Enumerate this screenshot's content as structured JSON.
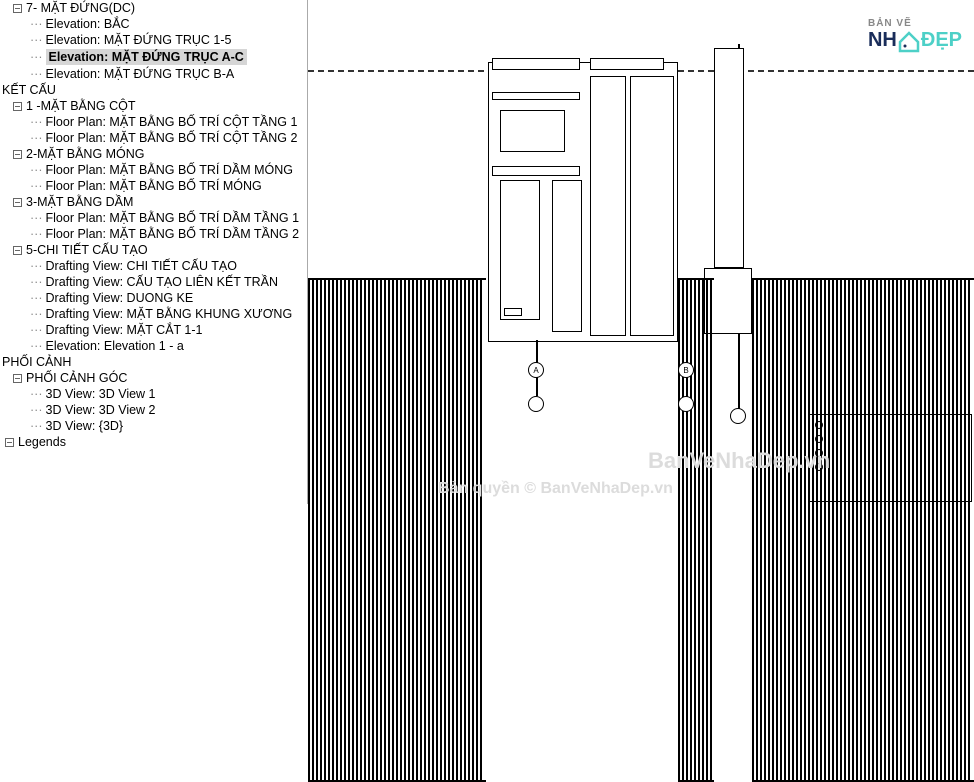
{
  "tree": {
    "group0": "7- MẶT ĐỨNG(DC)",
    "group0_items": [
      "Elevation: BẮC",
      "Elevation: MẶT ĐỨNG TRỤC 1-5",
      "Elevation: MẶT ĐỨNG TRỤC A-C",
      "Elevation: MẶT ĐỨNG TRỤC B-A"
    ],
    "group0_selected": 2,
    "section1": "KẾT CẤU",
    "group1": "1 -MẶT BẰNG CỘT",
    "group1_items": [
      "Floor Plan: MẶT BẰNG BỐ TRÍ CỘT TẦNG 1",
      "Floor Plan: MẶT BẰNG BỐ TRÍ CỘT TẦNG 2"
    ],
    "group2": "2-MẶT BẰNG MÓNG",
    "group2_items": [
      "Floor Plan: MẶT BẰNG BỐ TRÍ DẦM MÓNG",
      "Floor Plan: MẶT BẰNG BỐ TRÍ MÓNG"
    ],
    "group3": "3-MẶT BẰNG DẦM",
    "group3_items": [
      "Floor Plan: MẶT BẰNG BỐ TRÍ DẦM TẦNG 1",
      "Floor Plan: MẶT BẰNG BỐ TRÍ DẦM TẦNG 2"
    ],
    "group5": "5-CHI TIẾT CẤU TẠO",
    "group5_items": [
      "Drafting View: CHI TIẾT CẤU TẠO",
      "Drafting View: CẤU TẠO LIÊN KẾT TRẦN",
      "Drafting View: DUONG KE",
      "Drafting View: MẶT BẰNG KHUNG XƯƠNG",
      "Drafting View: MẶT CẮT 1-1",
      "Elevation: Elevation 1 - a"
    ],
    "section2": "PHỐI CẢNH",
    "group6": "PHỐI CẢNH GÓC",
    "group6_items": [
      "3D View: 3D View 1",
      "3D View: 3D View 2",
      "3D View: {3D}"
    ],
    "legends": "Legends"
  },
  "watermark": {
    "ban": "BẢN VẼ",
    "nh": "NH",
    "dep": "ĐẸP",
    "url": "BanVeNhaDep.vn",
    "copyright": "Bản quyền © BanVeNhaDep.vn"
  },
  "grid_labels": {
    "a": "A",
    "b": "B"
  }
}
